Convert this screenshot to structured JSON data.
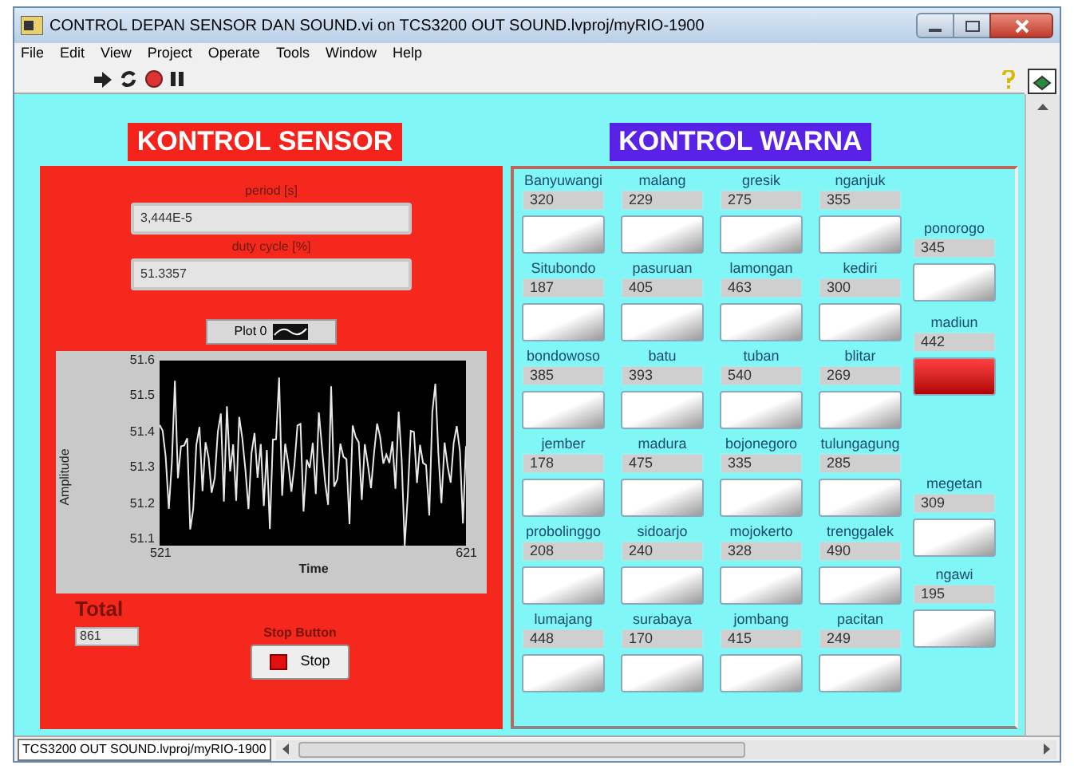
{
  "window": {
    "title": "CONTROL DEPAN SENSOR DAN SOUND.vi on TCS3200 OUT SOUND.lvproj/myRIO-1900"
  },
  "menu": [
    "File",
    "Edit",
    "View",
    "Project",
    "Operate",
    "Tools",
    "Window",
    "Help"
  ],
  "sensor": {
    "title": "KONTROL SENSOR",
    "fields": [
      {
        "label": "period [s]",
        "value": "3,444E-5"
      },
      {
        "label": "duty cycle [%]",
        "value": "51.3357"
      }
    ],
    "plot_legend": "Plot 0",
    "graph": {
      "ylabel": "Amplitude",
      "xlabel": "Time",
      "yticks": [
        "51.6",
        "51.5",
        "51.4",
        "51.3",
        "51.2",
        "51.1"
      ],
      "xticks": [
        "521",
        "621"
      ]
    },
    "total": {
      "label": "Total",
      "value": "861"
    },
    "stop": {
      "label": "Stop Button",
      "button": "Stop"
    }
  },
  "warna": {
    "title": "KONTROL WARNA",
    "grid_rows": [
      [
        {
          "name": "Banyuwangi",
          "value": "320",
          "on": false
        },
        {
          "name": "malang",
          "value": "229",
          "on": false
        },
        {
          "name": "gresik",
          "value": "275",
          "on": false
        },
        {
          "name": "nganjuk",
          "value": "355",
          "on": false
        }
      ],
      [
        {
          "name": "Situbondo",
          "value": "187",
          "on": false
        },
        {
          "name": "pasuruan",
          "value": "405",
          "on": false
        },
        {
          "name": "lamongan",
          "value": "463",
          "on": false
        },
        {
          "name": "kediri",
          "value": "300",
          "on": false
        }
      ],
      [
        {
          "name": "bondowoso",
          "value": "385",
          "on": false
        },
        {
          "name": "batu",
          "value": "393",
          "on": false
        },
        {
          "name": "tuban",
          "value": "540",
          "on": false
        },
        {
          "name": "blitar",
          "value": "269",
          "on": false
        }
      ],
      [
        {
          "name": "jember",
          "value": "178",
          "on": false
        },
        {
          "name": "madura",
          "value": "475",
          "on": false
        },
        {
          "name": "bojonegoro",
          "value": "335",
          "on": false
        },
        {
          "name": "tulungagung",
          "value": "285",
          "on": false
        }
      ],
      [
        {
          "name": "probolinggo",
          "value": "208",
          "on": false
        },
        {
          "name": "sidoarjo",
          "value": "240",
          "on": false
        },
        {
          "name": "mojokerto",
          "value": "328",
          "on": false
        },
        {
          "name": "trenggalek",
          "value": "490",
          "on": false
        }
      ],
      [
        {
          "name": "lumajang",
          "value": "448",
          "on": false
        },
        {
          "name": "surabaya",
          "value": "170",
          "on": false
        },
        {
          "name": "jombang",
          "value": "415",
          "on": false
        },
        {
          "name": "pacitan",
          "value": "249",
          "on": false
        }
      ]
    ],
    "side_column": [
      {
        "name": "ponorogo",
        "value": "345",
        "on": false
      },
      {
        "name": "madiun",
        "value": "442",
        "on": true
      },
      {
        "name": "megetan",
        "value": "309",
        "on": false
      },
      {
        "name": "ngawi",
        "value": "195",
        "on": false
      }
    ]
  },
  "status_bar": {
    "project": "TCS3200 OUT SOUND.lvproj/myRIO-1900"
  }
}
